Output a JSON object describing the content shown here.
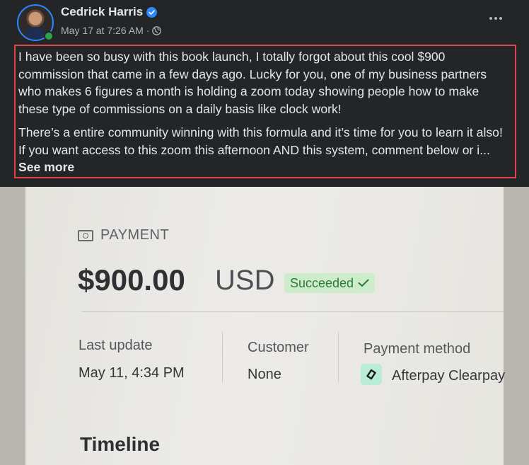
{
  "post": {
    "author": "Cedrick Harris",
    "timestamp": "May 17 at 7:26 AM",
    "separator": "·",
    "paragraph1": "I have been so busy with this book launch, I totally forgot about this cool $900 commission that came in a few days ago. Lucky for you, one of my business partners who makes 6 figures a month is holding a zoom today showing people how to make these type of commissions on a daily basis like clock work!",
    "paragraph2": "There’s a entire community winning with this formula and it’s time for you to learn it also! If you want access to this zoom this afternoon AND this system, comment below or i...",
    "see_more": "See more",
    "icons": [
      "verified-badge-icon",
      "globe-icon",
      "more-options-icon"
    ]
  },
  "photo": {
    "section_label": "PAYMENT",
    "amount": "$900.00",
    "currency": "USD",
    "status": "Succeeded",
    "columns": [
      {
        "label": "Last update",
        "value": "May 11, 4:34 PM"
      },
      {
        "label": "Customer",
        "value": "None"
      },
      {
        "label": "Payment method",
        "value": "Afterpay Clearpay"
      }
    ],
    "timeline_heading": "Timeline"
  },
  "colors": {
    "background": "#242526",
    "highlight_border": "#e0454b",
    "verified_blue": "#2d88ff",
    "online_green": "#31a24c",
    "status_green_bg": "#cdeccb"
  }
}
